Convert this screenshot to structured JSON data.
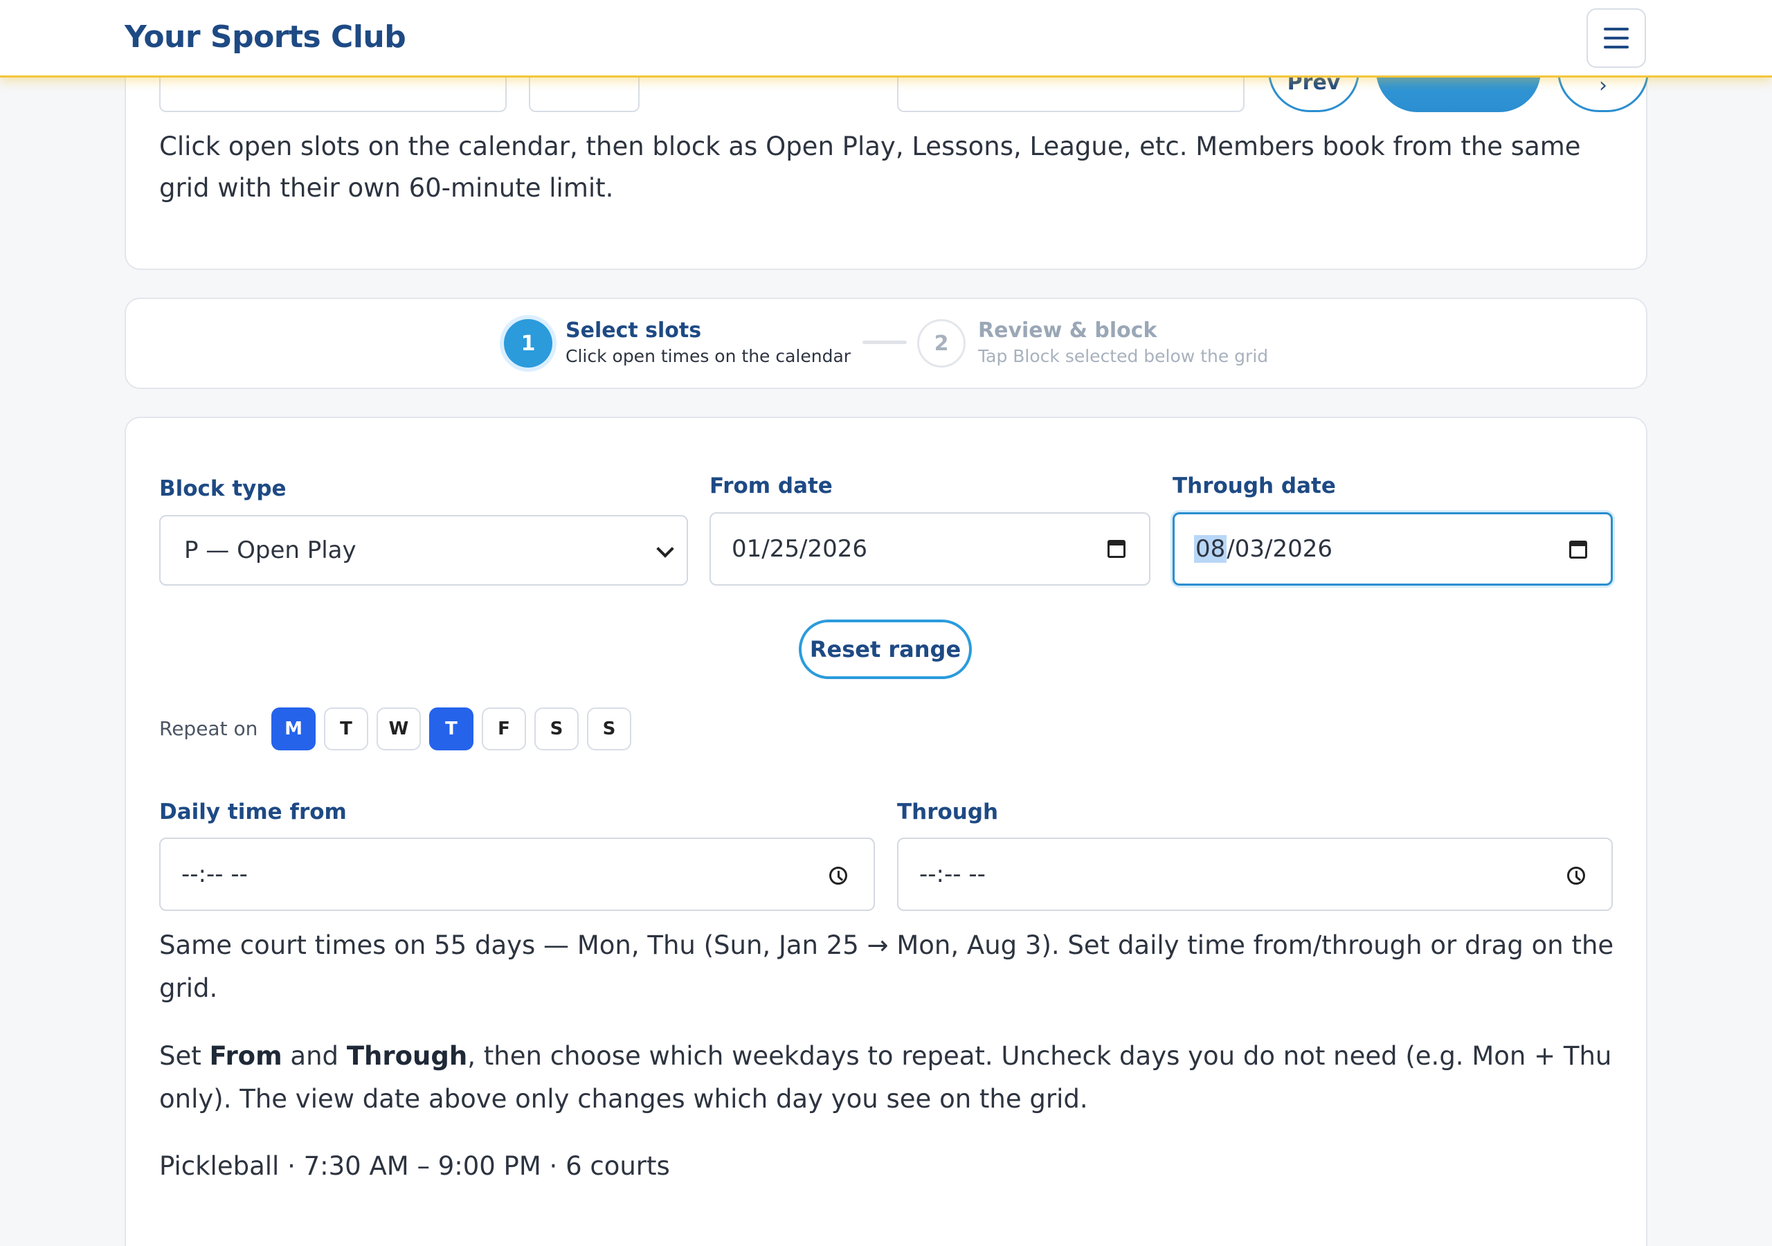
{
  "header": {
    "brand": "Your Sports Club"
  },
  "top_card": {
    "prev_label": "Prev",
    "intro": "Click open slots on the calendar, then block as Open Play, Lessons, League, etc. Members book from the same grid with their own 60-minute limit."
  },
  "stepper": {
    "steps": [
      {
        "number": "1",
        "title": "Select slots",
        "subtitle": "Click open times on the calendar"
      },
      {
        "number": "2",
        "title": "Review & block",
        "subtitle": "Tap Block selected below the grid"
      }
    ]
  },
  "form": {
    "block_type_label": "Block type",
    "block_type_value": "P — Open Play",
    "from_date_label": "From date",
    "from_date_value": "01/25/2026",
    "through_date_label": "Through date",
    "through_date_month": "08",
    "through_date_rest": "/03/2026",
    "reset_label": "Reset range",
    "repeat_label": "Repeat on",
    "days": [
      "M",
      "T",
      "W",
      "T",
      "F",
      "S",
      "S"
    ],
    "daily_from_label": "Daily time from",
    "daily_from_value": "--:-- --",
    "daily_through_label": "Through",
    "daily_through_value": "--:-- --"
  },
  "summary": {
    "line1": "Same court times on 55 days — Mon, Thu (Sun, Jan 25 → Mon, Aug 3). Set daily time from/through or drag on the grid.",
    "line2_a": "Set ",
    "line2_from": "From",
    "line2_b": " and ",
    "line2_through": "Through",
    "line2_c": ", then choose which weekdays to repeat. Uncheck days you do not need (e.g. Mon + Thu only). The view date above only changes which day you see on the grid.",
    "facility": "Pickleball · 7:30 AM – 9:00 PM · 6 courts"
  },
  "colors": {
    "brand": "#1e4a84",
    "accent": "#2b9bdc",
    "day_active": "#2563eb",
    "topbar_border": "#f3c53a"
  }
}
